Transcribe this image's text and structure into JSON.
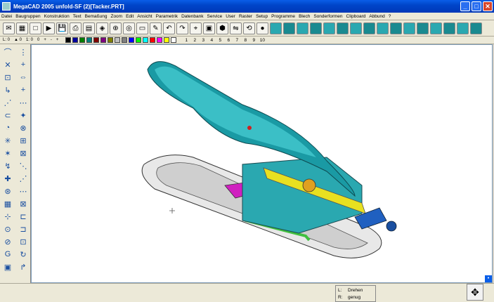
{
  "window": {
    "title": "MegaCAD 2005 unfold-SF (2)[Tacker.PRT]",
    "minimize": "_",
    "maximize": "□",
    "close": "✕"
  },
  "menu": [
    "Datei",
    "Baugruppen",
    "Konstruktion",
    "Text",
    "Bemaßung",
    "Zoom",
    "Edit",
    "Ansicht",
    "Parametrik",
    "Datenbank",
    "Service",
    "User",
    "Raster",
    "Setup",
    "Programme",
    "Blech",
    "Sonderformen",
    "Clipboard",
    "Abbund",
    "?"
  ],
  "toolbar": {
    "icons": [
      "envelope-icon",
      "grid-icon",
      "new-file-icon",
      "open-folder-icon",
      "save-icon",
      "print-icon",
      "plot-icon",
      "layer-icon",
      "zoom-icon",
      "view-icon",
      "monitor-icon",
      "erase-icon",
      "undo-icon",
      "redo-icon",
      "snap-icon",
      "box-icon",
      "solid-icon",
      "mirror-icon",
      "rotate-icon",
      "sphere-icon"
    ]
  },
  "toolbar2": {
    "items": [
      "L: 0",
      "▲ 0",
      "1: 0",
      "0",
      "+",
      "-",
      "+"
    ],
    "colors": [
      "#000000",
      "#0000a0",
      "#008000",
      "#008080",
      "#800000",
      "#800080",
      "#808000",
      "#c0c0c0",
      "#808080",
      "#0000ff",
      "#00ff00",
      "#00ffff",
      "#ff0000",
      "#ff00ff",
      "#ffff00",
      "#ffffff"
    ],
    "numbers": [
      "1",
      "2",
      "3",
      "4",
      "5",
      "6",
      "7",
      "8",
      "9",
      "10"
    ]
  },
  "status": {
    "l_key": "L:",
    "l_val": "Drehen",
    "r_key": "R:",
    "r_val": "genug"
  }
}
